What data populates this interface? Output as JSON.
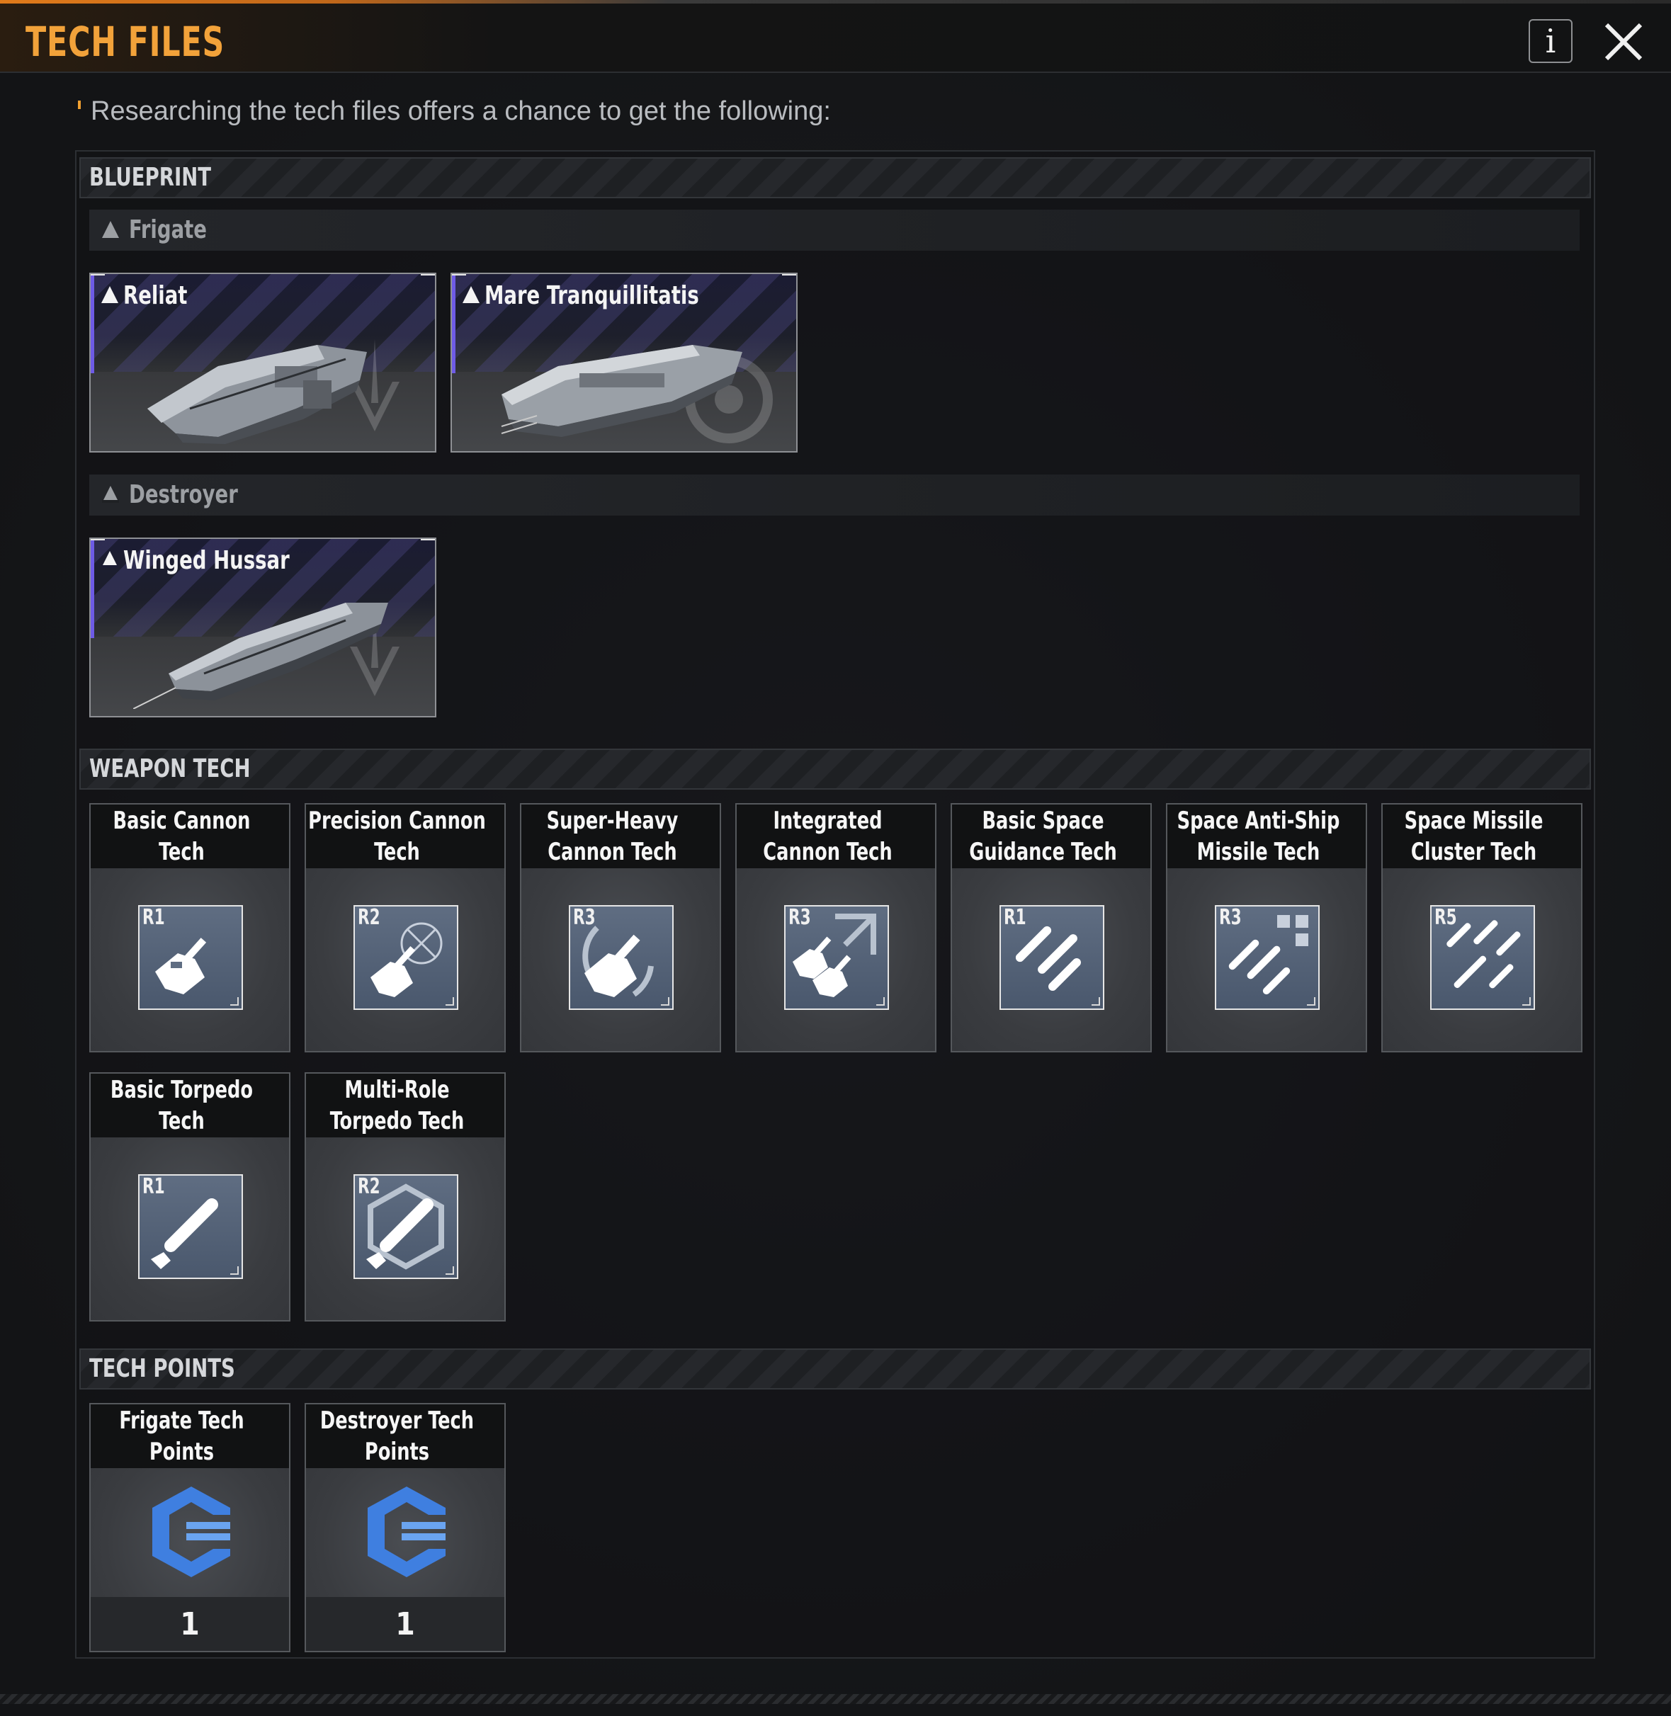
{
  "header": {
    "title": "TECH FILES",
    "info_label": "i"
  },
  "subtitle": "Researching the tech files offers a chance to get the following:",
  "colors": {
    "accent_orange": "#f2a23a",
    "blueprint_purple": "#6e5be6",
    "tech_points_blue": "#3f7fe0"
  },
  "blueprint": {
    "label": "BLUEPRINT",
    "groups": [
      {
        "label": "Frigate",
        "ships": [
          {
            "name": "Reliat"
          },
          {
            "name": "Mare Tranquillitatis"
          }
        ]
      },
      {
        "label": "Destroyer",
        "ships": [
          {
            "name": "Winged Hussar"
          }
        ]
      }
    ]
  },
  "weapon_tech": {
    "label": "WEAPON TECH",
    "items": [
      {
        "name": "Basic Cannon Tech",
        "rank": "R1",
        "icon": "cannon-icon"
      },
      {
        "name": "Precision Cannon Tech",
        "rank": "R2",
        "icon": "cannon-icon"
      },
      {
        "name": "Super-Heavy Cannon Tech",
        "rank": "R3",
        "icon": "cannon-icon"
      },
      {
        "name": "Integrated Cannon Tech",
        "rank": "R3",
        "icon": "cannon-icon"
      },
      {
        "name": "Basic Space Guidance Tech",
        "rank": "R1",
        "icon": "missile-icon"
      },
      {
        "name": "Space Anti-Ship Missile Tech",
        "rank": "R3",
        "icon": "missile-icon"
      },
      {
        "name": "Space Missile Cluster Tech",
        "rank": "R5",
        "icon": "missile-icon"
      },
      {
        "name": "Basic Torpedo Tech",
        "rank": "R1",
        "icon": "torpedo-icon"
      },
      {
        "name": "Multi-Role Torpedo Tech",
        "rank": "R2",
        "icon": "torpedo-icon"
      }
    ]
  },
  "tech_points": {
    "label": "TECH POINTS",
    "items": [
      {
        "name": "Frigate Tech Points",
        "count": "1",
        "icon": "tech-points-icon"
      },
      {
        "name": "Destroyer Tech Points",
        "count": "1",
        "icon": "tech-points-icon"
      }
    ]
  }
}
